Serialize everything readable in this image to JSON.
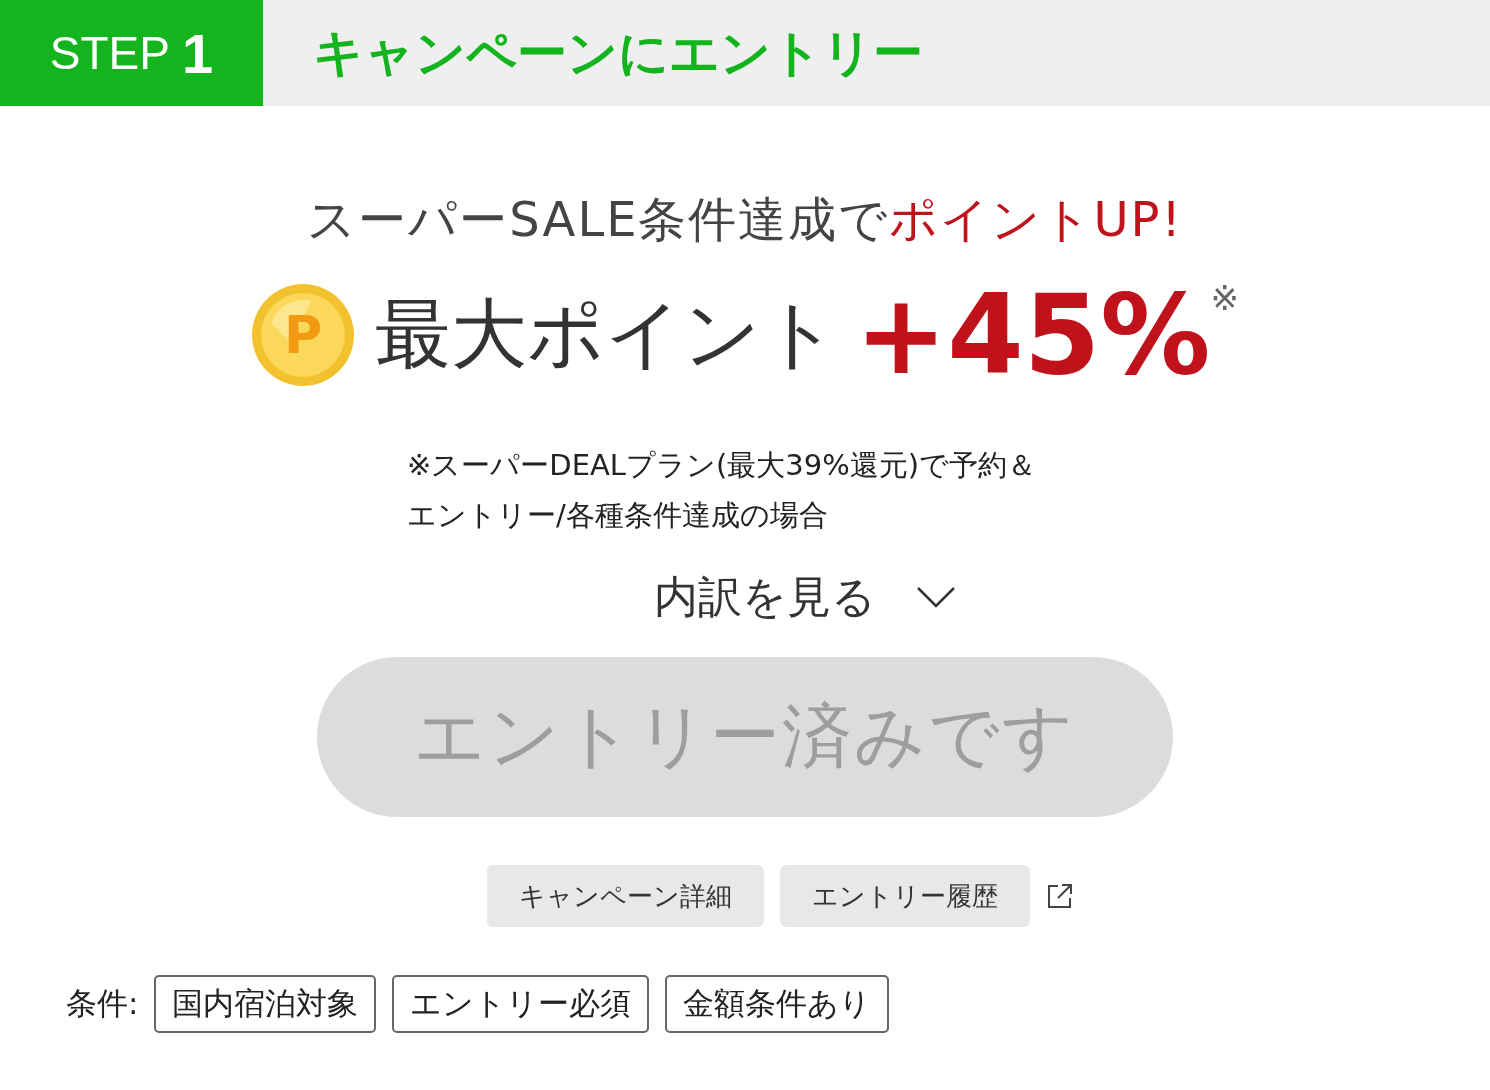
{
  "header": {
    "step_label": "STEP",
    "step_number": "1",
    "title": "キャンペーンにエントリー"
  },
  "headline": {
    "lead": "スーパーSALE条件達成で",
    "highlight": "ポイントUP!"
  },
  "max_points": {
    "coin": "P",
    "label": "最大ポイント",
    "value": "+45%",
    "mark": "※"
  },
  "note": [
    "※スーパーDEALプラン(最大39%還元)で予約＆",
    "エントリー/各種条件達成の場合"
  ],
  "breakdown": {
    "label": "内訳を見る",
    "expanded": false
  },
  "entry_button": {
    "label": "エントリー済みです",
    "disabled": true
  },
  "links": [
    {
      "label": "キャンペーン詳細",
      "external": false
    },
    {
      "label": "エントリー履歴",
      "external": true
    }
  ],
  "conditions": {
    "label": "条件:",
    "tags": [
      "国内宿泊対象",
      "エントリー必須",
      "金額条件あり"
    ]
  }
}
